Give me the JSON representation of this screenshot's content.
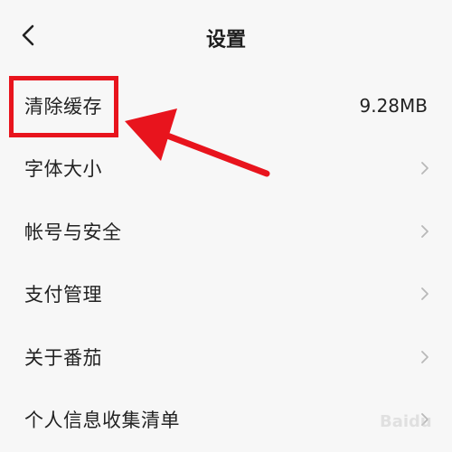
{
  "header": {
    "title": "设置",
    "back_icon": "chevron-left-icon"
  },
  "settings": {
    "items": [
      {
        "label": "清除缓存",
        "value": "9.28MB"
      },
      {
        "label": "字体大小",
        "icon": "chevron-right-icon"
      },
      {
        "label": "帐号与安全",
        "icon": "chevron-right-icon"
      },
      {
        "label": "支付管理",
        "icon": "chevron-right-icon"
      },
      {
        "label": "关于番茄",
        "icon": "chevron-right-icon"
      },
      {
        "label": "个人信息收集清单",
        "icon": "chevron-right-icon"
      }
    ]
  },
  "annotation": {
    "color": "#e8141d",
    "icon": "red-arrow-annotation"
  },
  "watermark": {
    "text": "Baidu",
    "icon": "baidu-paw-logo"
  },
  "colors": {
    "background": "#f7f7f7",
    "text": "#222222",
    "chevron": "#b8b8b8"
  }
}
